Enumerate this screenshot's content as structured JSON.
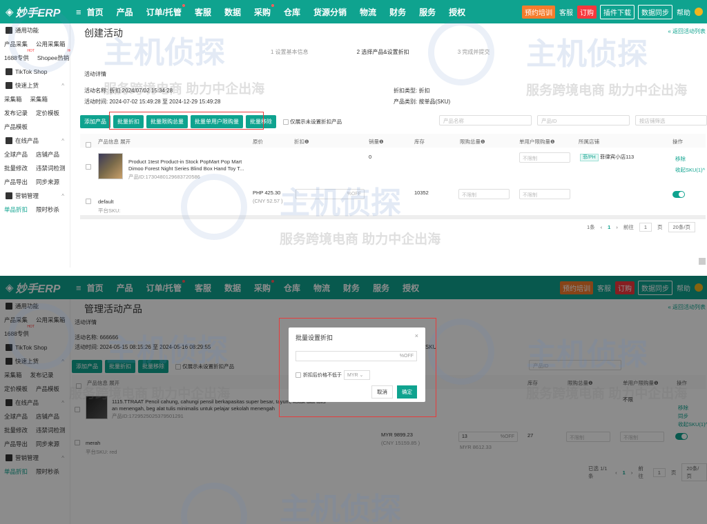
{
  "app": {
    "logo": "妙手ERP",
    "menu_icon": "menu-icon"
  },
  "nav": [
    "首页",
    "产品",
    "订单/托管",
    "客服",
    "数据",
    "采购",
    "仓库",
    "货源分销",
    "物流",
    "财务",
    "服务",
    "授权"
  ],
  "topright": {
    "training": "预约培训",
    "customer_service": "客服",
    "order": "订购",
    "plugin": "插件下载",
    "sync": "数据同步",
    "help": "帮助"
  },
  "sidebar": {
    "common": "通用功能",
    "row1": [
      "产品采集",
      "公用采集箱"
    ],
    "row2": [
      "1688专供",
      "Shopee热销"
    ],
    "tiktok": "TikTok Shop",
    "quick": "快速上货",
    "row3": [
      "采集箱",
      "采集箱"
    ],
    "row4": [
      "发布记录",
      "定价模板"
    ],
    "row5": [
      "产品模板"
    ],
    "online": "在线产品",
    "row6": [
      "全球产品",
      "店铺产品"
    ],
    "row7": [
      "批量修改",
      "违禁词检测"
    ],
    "row8": [
      "产品导出",
      "同步来源"
    ],
    "marketing": "营销管理",
    "row9": [
      "单品折扣",
      "限时秒杀"
    ]
  },
  "s1": {
    "title": "创建活动",
    "back": "« 返回活动列表",
    "steps": [
      "1  设置基本信息",
      "2  选择产品&设置折扣",
      "3  完成并提交"
    ],
    "section": "活动详情",
    "name_label": "活动名称:  折扣 2024/07/02 15:34:28",
    "time_label": "活动时间:  2024-07-02 15:49:28 至 2024-12-29 15:49:28",
    "type_label": "折扣类型:  折扣",
    "prodtype_label": "产品类别:  按单品(SKU)",
    "buttons": [
      "添加产品",
      "批量折扣",
      "批量限购总量",
      "批量单用户限购量",
      "批量移除"
    ],
    "only_unset": "仅展示未设置折扣产品",
    "filters": [
      "产品名称",
      "产品ID",
      "按店铺筛选"
    ],
    "headers": [
      "产品信息  展开",
      "原价",
      "折扣❶",
      "销量❶",
      "库存",
      "限购总量❶",
      "单用户限购量❶",
      "所属店铺",
      "操作"
    ],
    "product_line1": "Product 1test Product-in Stock PopMart Pop Mart",
    "product_line2": "Dimoo Forest Night Series Blind Box Hand Toy T...",
    "product_id": "产品ID:1730480129683720586",
    "sales": "0",
    "unlimited": "不限制",
    "region": "菲/PH",
    "shop": "菲律宾小店113",
    "remove": "移除",
    "collapse": "收起SKU(1)^",
    "sku_name": "default",
    "sku_platform": "平台SKU:",
    "price": "PHP 425.30",
    "price_cny": "(CNY 52.57 )",
    "off": "%OFF",
    "stock": "10352",
    "pager_total": "1条",
    "pager_page": "1",
    "pager_goto": "前往",
    "pager_input": "1",
    "pager_unit": "页",
    "pager_size": "20条/页"
  },
  "s2": {
    "title": "管理活动产品",
    "back": "« 返回活动列表",
    "section": "活动详情",
    "name_label": "活动名称:  666666",
    "time_label": "活动时间:  2024-05-15 08:15:26 至 2024-05-16 08:29:55",
    "prodtype_label": "按SKU",
    "buttons": [
      "添加产品",
      "批量折扣",
      "批量移除"
    ],
    "only_unset": "仅展示未设置折扣产品",
    "filters": [
      "产品ID"
    ],
    "headers": [
      "产品信息  展开",
      "库存",
      "限购总量❶",
      "单用户限购量❶",
      "操作"
    ],
    "product_line1": "1115.TTRAAT Pencil cahung, cahungi pensil berkapasitas super besar, tayum, kotak alat tulis",
    "product_line2": "an menengah, beg alat tulis minimalis untuk pelajar sekolah menengah",
    "product_id": "产品ID:1729525025379501291",
    "stock_val": "不限",
    "remove": "移除",
    "sync": "同步",
    "collapse": "收起SKU(1)^",
    "sku_name": "merah",
    "sku_platform": "平台SKU:  red",
    "price": "MYR 9899.23",
    "price_cny": "(CNY 15159.85 )",
    "disc_val": "13",
    "off": "%OFF",
    "after": "MYR 8612.33",
    "stock": "27",
    "unlimited": "不限制",
    "pager_total": "已选 1/1条",
    "pager_page": "1",
    "pager_goto": "前往",
    "pager_input": "1",
    "pager_unit": "页",
    "pager_size": "20条/页"
  },
  "modal": {
    "title": "批量设置折扣",
    "input_suffix": "%OFF",
    "check_label": "折扣后价格不低于",
    "currency": "MYR",
    "cancel": "取消",
    "confirm": "确定"
  },
  "watermark": {
    "main": "主机侦探",
    "sub": "服务跨境电商 助力中企出海"
  }
}
